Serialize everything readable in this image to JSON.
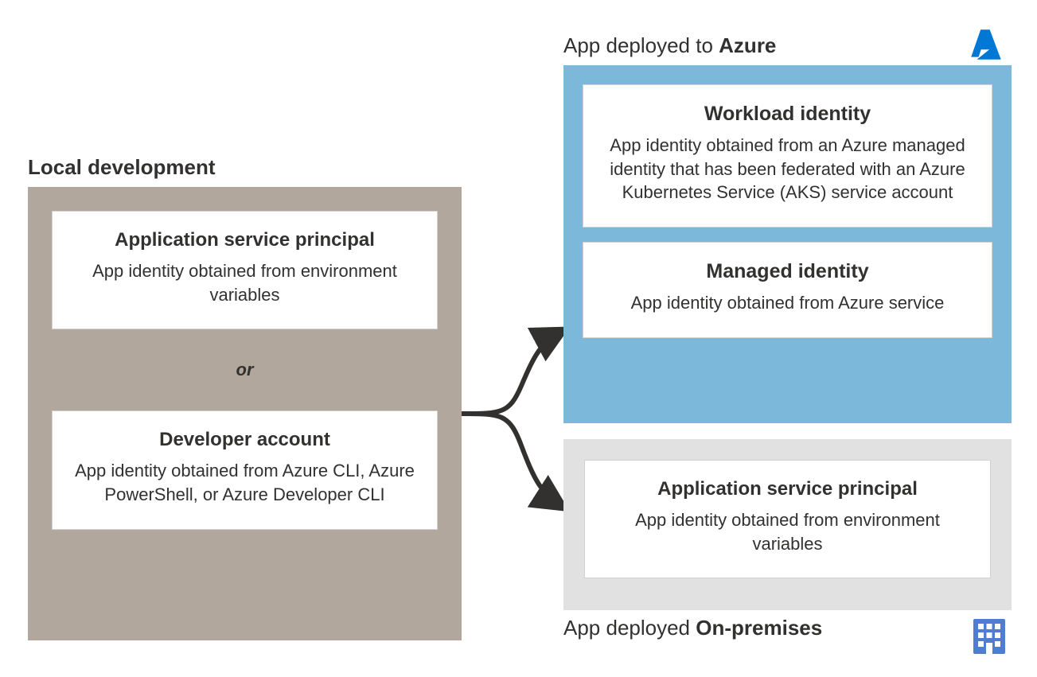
{
  "local": {
    "title": "Local development",
    "card1": {
      "title": "Application service principal",
      "desc": "App identity obtained from environment variables"
    },
    "or": "or",
    "card2": {
      "title": "Developer account",
      "desc": "App identity obtained from Azure CLI, Azure PowerShell, or Azure Developer CLI"
    }
  },
  "azure": {
    "title_pre": "App deployed to ",
    "title_bold": "Azure",
    "card1": {
      "title": "Workload identity",
      "desc": "App identity obtained from an Azure managed identity that has been federated with an Azure Kubernetes Service (AKS) service account"
    },
    "card2": {
      "title": "Managed identity",
      "desc": "App identity obtained from Azure service"
    }
  },
  "onprem": {
    "title_pre": "App deployed ",
    "title_bold": "On-premises",
    "card": {
      "title": "Application service principal",
      "desc": "App identity obtained from environment variables"
    }
  },
  "colors": {
    "local_bg": "#b1a79c",
    "azure_bg": "#7bb8da",
    "onprem_bg": "#e1e1e1",
    "azure_logo": "#0078d4",
    "building": "#4f7dd1"
  }
}
